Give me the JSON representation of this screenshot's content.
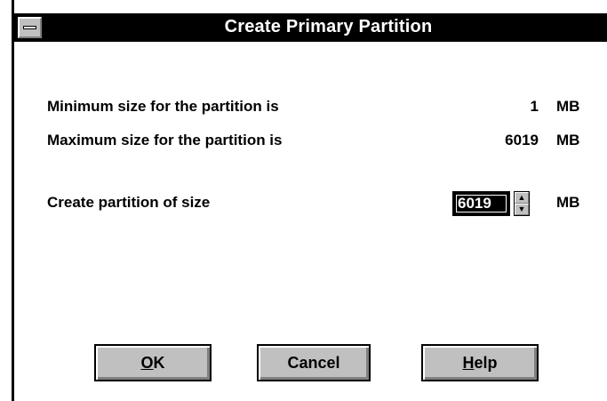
{
  "dialog": {
    "title": "Create Primary Partition",
    "min_label": "Minimum size for the partition is",
    "min_value": "1",
    "max_label": "Maximum size for the partition is",
    "max_value": "6019",
    "create_label": "Create partition of size",
    "size_input_value": "6019",
    "unit": "MB"
  },
  "buttons": {
    "ok_underlined": "O",
    "ok_rest": "K",
    "cancel": "Cancel",
    "help_underlined": "H",
    "help_rest": "elp"
  },
  "icons": {
    "system_menu": "system-menu-icon",
    "spin_up": "up-arrow-icon",
    "spin_down": "down-arrow-icon"
  },
  "colors": {
    "titlebar_bg": "#000000",
    "titlebar_text": "#ffffff",
    "button_face": "#c0c0c0",
    "window_bg": "#ffffff"
  }
}
